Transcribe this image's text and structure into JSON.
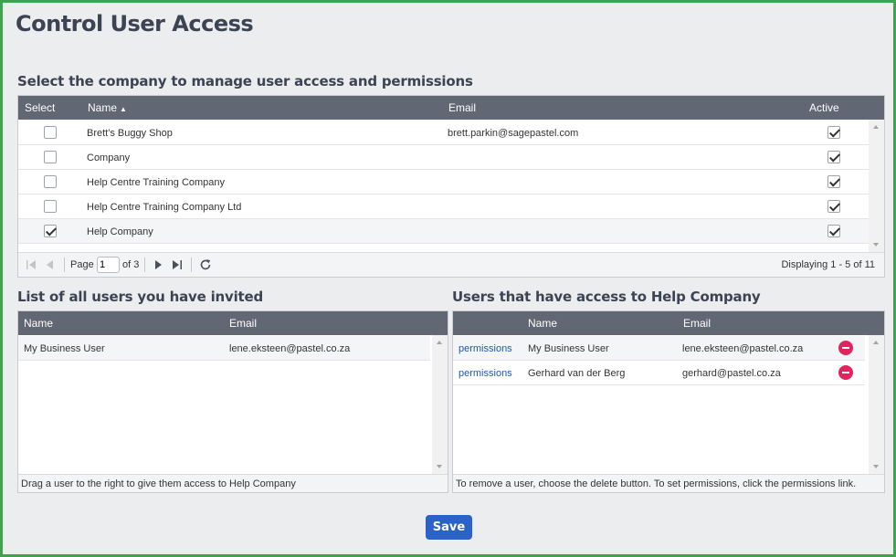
{
  "page_title": "Control User Access",
  "companies_section": {
    "heading": "Select the company to manage user access and permissions",
    "columns": {
      "select": "Select",
      "name": "Name",
      "email": "Email",
      "active": "Active"
    },
    "rows": [
      {
        "selected": false,
        "name": "Brett's Buggy Shop",
        "email": "brett.parkin@sagepastel.com",
        "active": true
      },
      {
        "selected": false,
        "name": "Company",
        "email": "",
        "active": true
      },
      {
        "selected": false,
        "name": "Help Centre Training Company",
        "email": "",
        "active": true
      },
      {
        "selected": false,
        "name": "Help Centre Training Company Ltd",
        "email": "",
        "active": true
      },
      {
        "selected": true,
        "name": "Help Company",
        "email": "",
        "active": true
      }
    ],
    "pager": {
      "page_label": "Page",
      "page_value": "1",
      "of_label": "of 3",
      "display_text": "Displaying 1 - 5 of 11"
    }
  },
  "invited_section": {
    "heading": "List of all users you have invited",
    "columns": {
      "name": "Name",
      "email": "Email"
    },
    "rows": [
      {
        "name": "My Business User",
        "email": "lene.eksteen@pastel.co.za"
      }
    ],
    "footer": "Drag a user to the right to give them access to Help Company"
  },
  "access_section": {
    "heading": "Users that have access to Help Company",
    "columns": {
      "name": "Name",
      "email": "Email"
    },
    "rows": [
      {
        "link": "permissions",
        "name": "My Business User",
        "email": "lene.eksteen@pastel.co.za"
      },
      {
        "link": "permissions",
        "name": "Gerhard van der Berg",
        "email": "gerhard@pastel.co.za"
      }
    ],
    "footer": "To remove a user, choose the delete button. To set permissions, click the permissions link."
  },
  "save_label": "Save",
  "colors": {
    "frame_border": "#3fa34d",
    "header_bg": "#616773",
    "link": "#1f58b8",
    "delete": "#e0245e",
    "save_button": "#2a62c7"
  }
}
